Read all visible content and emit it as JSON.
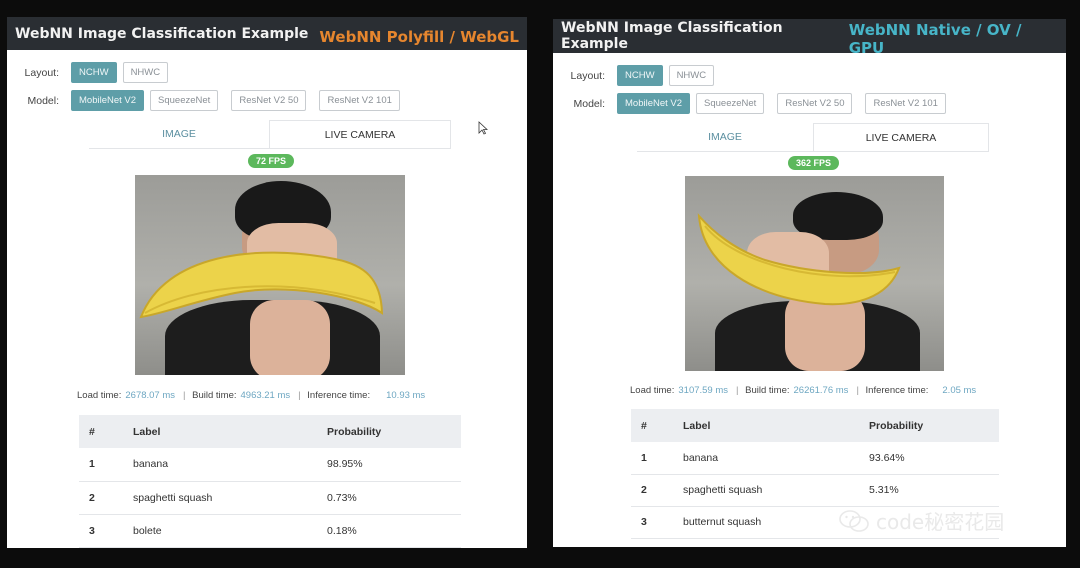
{
  "colors": {
    "polyfill_accent": "#e6862e",
    "native_accent": "#47b5c8",
    "active_option": "#5e9ea8",
    "fps_badge": "#5cb85c",
    "stat_value": "#6ea7c2"
  },
  "left": {
    "app_title": "WebNN Image Classification Example",
    "backend_label": "WebNN Polyfill / WebGL",
    "layout_label": "Layout:",
    "layout_options": [
      "NCHW",
      "NHWC"
    ],
    "layout_selected": "NCHW",
    "model_label": "Model:",
    "model_options": [
      "MobileNet V2",
      "SqueezeNet",
      "ResNet V2 50",
      "ResNet V2 101"
    ],
    "model_selected": "MobileNet V2",
    "tabs": [
      "IMAGE",
      "LIVE CAMERA"
    ],
    "tab_selected": "LIVE CAMERA",
    "fps": "72 FPS",
    "load_time_label": "Load time:",
    "load_time": "2678.07 ms",
    "build_time_label": "Build time:",
    "build_time": "4963.21 ms",
    "inference_time_label": "Inference time:",
    "inference_time": "10.93 ms",
    "table_headers": [
      "#",
      "Label",
      "Probability"
    ],
    "results": [
      {
        "rank": "1",
        "label": "banana",
        "prob": "98.95%"
      },
      {
        "rank": "2",
        "label": "spaghetti squash",
        "prob": "0.73%"
      },
      {
        "rank": "3",
        "label": "bolete",
        "prob": "0.18%"
      }
    ]
  },
  "right": {
    "app_title": "WebNN Image Classification Example",
    "backend_label": "WebNN Native / OV / GPU",
    "layout_label": "Layout:",
    "layout_options": [
      "NCHW",
      "NHWC"
    ],
    "layout_selected": "NCHW",
    "model_label": "Model:",
    "model_options": [
      "MobileNet V2",
      "SqueezeNet",
      "ResNet V2 50",
      "ResNet V2 101"
    ],
    "model_selected": "MobileNet V2",
    "tabs": [
      "IMAGE",
      "LIVE CAMERA"
    ],
    "tab_selected": "LIVE CAMERA",
    "fps": "362 FPS",
    "load_time_label": "Load time:",
    "load_time": "3107.59 ms",
    "build_time_label": "Build time:",
    "build_time": "26261.76 ms",
    "inference_time_label": "Inference time:",
    "inference_time": "2.05 ms",
    "table_headers": [
      "#",
      "Label",
      "Probability"
    ],
    "results": [
      {
        "rank": "1",
        "label": "banana",
        "prob": "93.64%"
      },
      {
        "rank": "2",
        "label": "spaghetti squash",
        "prob": "5.31%"
      },
      {
        "rank": "3",
        "label": "butternut squash",
        "prob": ""
      }
    ]
  },
  "watermark": {
    "text": "code秘密花园",
    "icon": "wechat-icon"
  }
}
